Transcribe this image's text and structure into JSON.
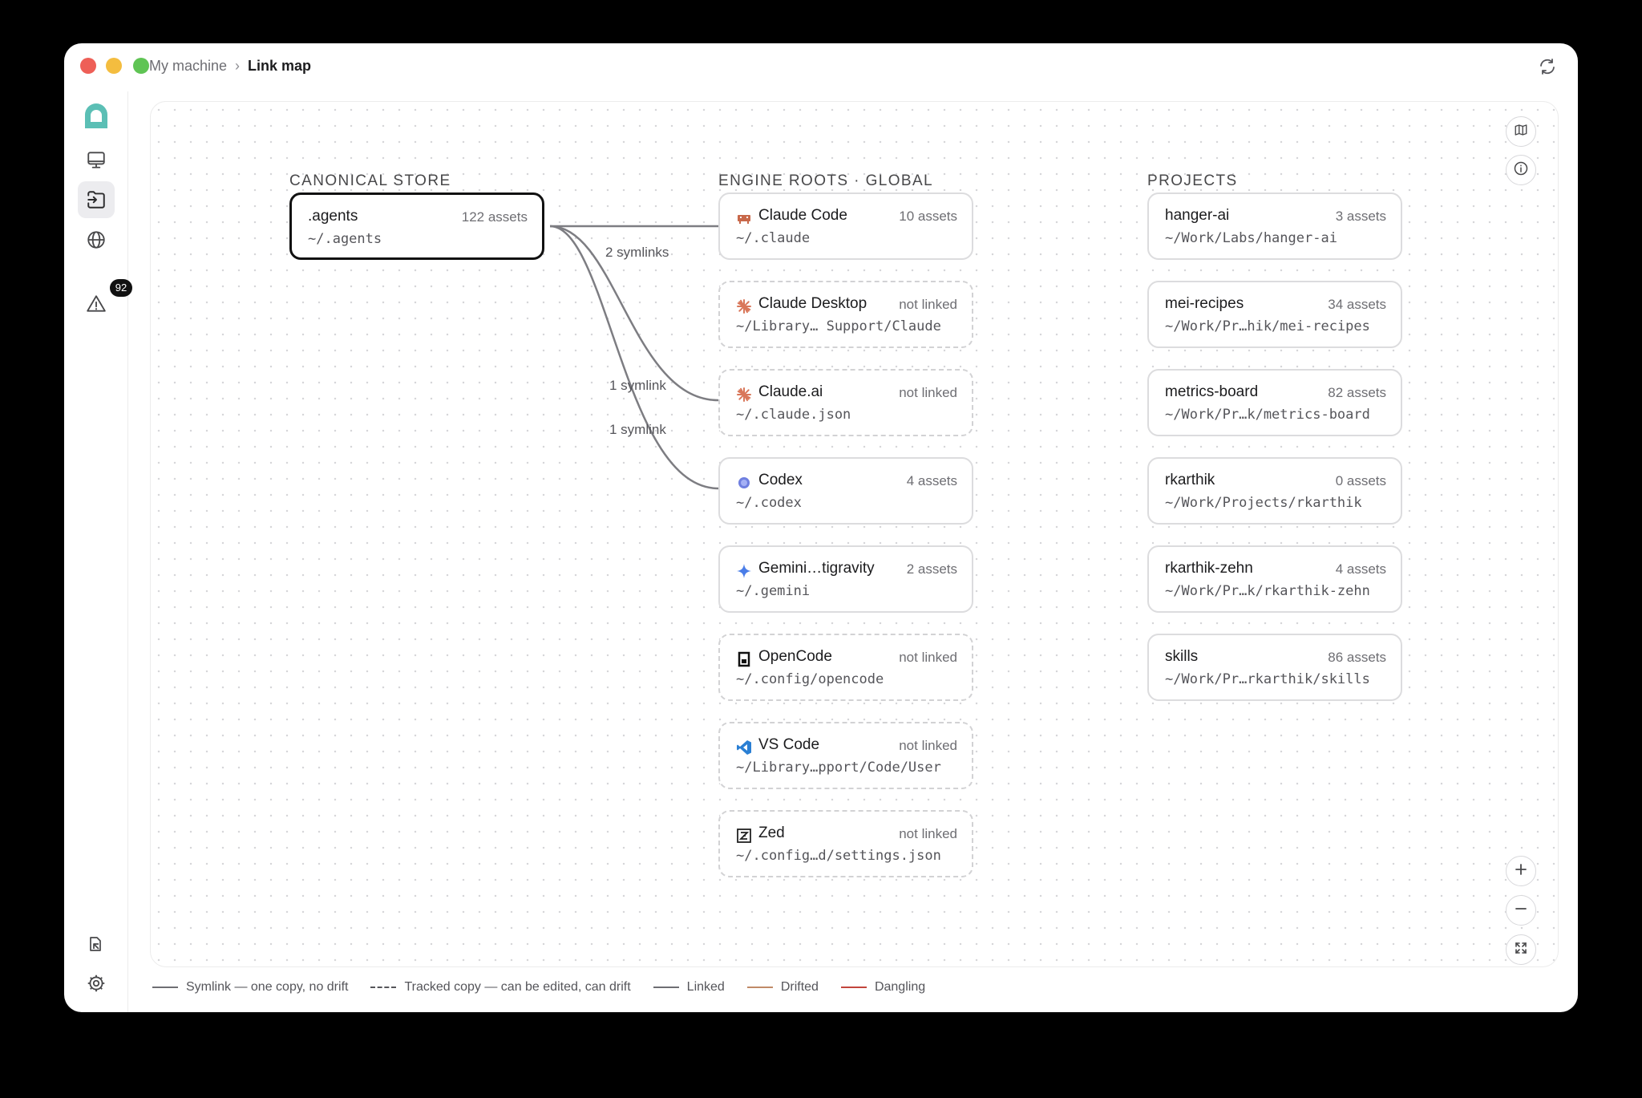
{
  "window": {
    "breadcrumb": {
      "parent": "My machine",
      "separator": "›",
      "current": "Link map"
    }
  },
  "sidebar": {
    "alerts_badge": "92",
    "items": [
      {
        "icon": "app-logo-icon"
      },
      {
        "icon": "monitor-icon"
      },
      {
        "icon": "link-map-icon",
        "active": true
      },
      {
        "icon": "globe-icon"
      },
      {
        "icon": "warning-icon"
      },
      {
        "icon": "docs-icon"
      },
      {
        "icon": "gear-icon"
      }
    ]
  },
  "map": {
    "columns": {
      "store": "CANONICAL STORE",
      "engines": "ENGINE ROOTS · GLOBAL",
      "projects": "PROJECTS"
    },
    "store": {
      "name": ".agents",
      "count": "122 assets",
      "path": "~/.agents"
    },
    "engines": [
      {
        "name": "Claude Code",
        "count": "10 assets",
        "path": "~/.claude",
        "linked": true,
        "icon": "claude-code-icon"
      },
      {
        "name": "Claude Desktop",
        "count": "not linked",
        "path": "~/Library… Support/Claude",
        "linked": false,
        "icon": "claude-sunburst-icon"
      },
      {
        "name": "Claude.ai",
        "count": "not linked",
        "path": "~/.claude.json",
        "linked": false,
        "icon": "claude-sunburst-icon"
      },
      {
        "name": "Codex",
        "count": "4 assets",
        "path": "~/.codex",
        "linked": true,
        "icon": "codex-icon"
      },
      {
        "name": "Gemini…tigravity",
        "count": "2 assets",
        "path": "~/.gemini",
        "linked": true,
        "icon": "gemini-icon"
      },
      {
        "name": "OpenCode",
        "count": "not linked",
        "path": "~/.config/opencode",
        "linked": false,
        "icon": "opencode-icon"
      },
      {
        "name": "VS Code",
        "count": "not linked",
        "path": "~/Library…pport/Code/User",
        "linked": false,
        "icon": "vscode-icon"
      },
      {
        "name": "Zed",
        "count": "not linked",
        "path": "~/.config…d/settings.json",
        "linked": false,
        "icon": "zed-icon"
      }
    ],
    "projects": [
      {
        "name": "hanger-ai",
        "count": "3 assets",
        "path": "~/Work/Labs/hanger-ai"
      },
      {
        "name": "mei-recipes",
        "count": "34 assets",
        "path": "~/Work/Pr…hik/mei-recipes"
      },
      {
        "name": "metrics-board",
        "count": "82 assets",
        "path": "~/Work/Pr…k/metrics-board"
      },
      {
        "name": "rkarthik",
        "count": "0 assets",
        "path": "~/Work/Projects/rkarthik"
      },
      {
        "name": "rkarthik-zehn",
        "count": "4 assets",
        "path": "~/Work/Pr…k/rkarthik-zehn"
      },
      {
        "name": "skills",
        "count": "86 assets",
        "path": "~/Work/Pr…rkarthik/skills"
      }
    ],
    "edge_labels": [
      "2 symlinks",
      "1 symlink",
      "1 symlink"
    ]
  },
  "legend": [
    {
      "label": "Symlink — one copy, no drift",
      "style": "solid",
      "color": "#6e6e73"
    },
    {
      "label": "Tracked copy — can be edited, can drift",
      "style": "dashed",
      "color": "#55555a"
    },
    {
      "label": "Linked",
      "style": "solid",
      "color": "#6e6e73"
    },
    {
      "label": "Drifted",
      "style": "solid",
      "color": "#c08a68"
    },
    {
      "label": "Dangling",
      "style": "solid",
      "color": "#c2453c"
    }
  ],
  "colors": {
    "accent": "#5bbfb5",
    "badge": "#111111",
    "red": "#ee5f57",
    "yellow": "#f4bd3f",
    "green": "#5fc454"
  }
}
